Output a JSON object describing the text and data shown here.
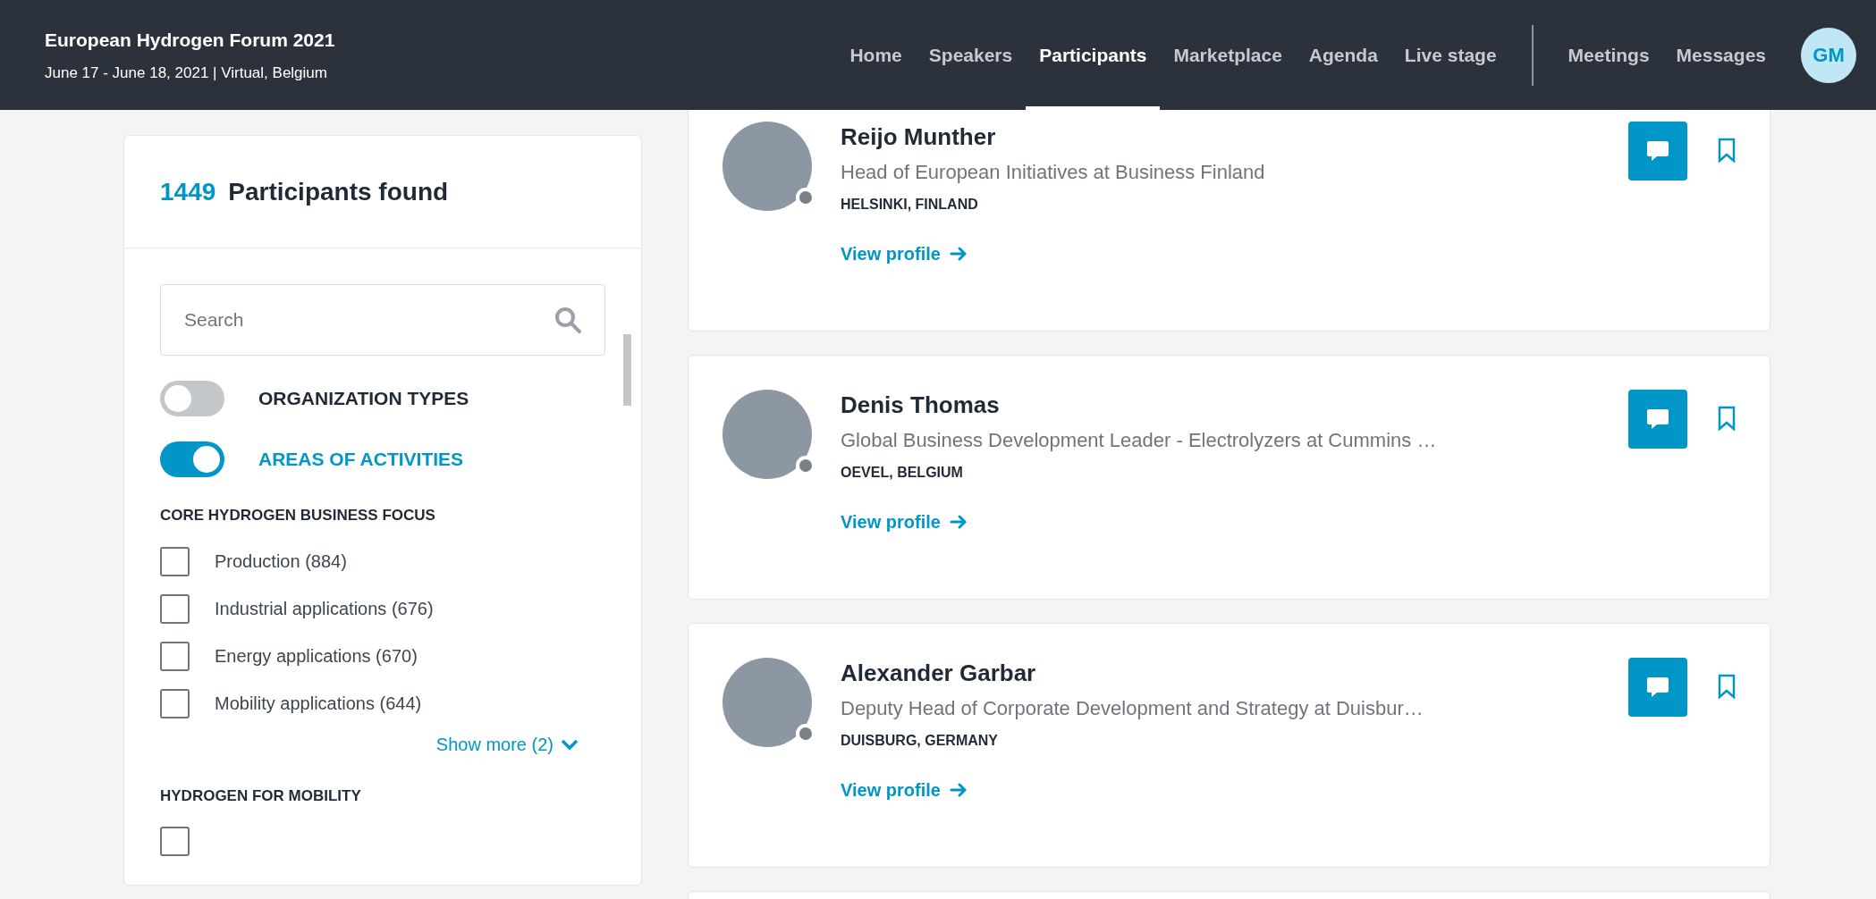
{
  "event": {
    "title": "European Hydrogen Forum 2021",
    "subtitle": "June 17 - June 18, 2021 | Virtual, Belgium"
  },
  "nav": {
    "main": [
      {
        "label": "Home",
        "selected": false
      },
      {
        "label": "Speakers",
        "selected": false
      },
      {
        "label": "Participants",
        "selected": true
      },
      {
        "label": "Marketplace",
        "selected": false
      },
      {
        "label": "Agenda",
        "selected": false
      },
      {
        "label": "Live stage",
        "selected": false
      }
    ],
    "personal": [
      {
        "label": "Meetings",
        "selected": false
      },
      {
        "label": "Messages",
        "selected": false
      }
    ]
  },
  "user": {
    "initials": "GM"
  },
  "filters": {
    "count": "1449",
    "count_label": "Participants found",
    "search": {
      "placeholder": "Search"
    },
    "toggles": [
      {
        "label": "ORGANIZATION TYPES",
        "on": false
      },
      {
        "label": "AREAS OF ACTIVITIES",
        "on": true
      }
    ],
    "sections": [
      {
        "title": "CORE HYDROGEN BUSINESS FOCUS",
        "items": [
          {
            "label": "Production (884)",
            "checked": false
          },
          {
            "label": "Industrial applications (676)",
            "checked": false
          },
          {
            "label": "Energy applications (670)",
            "checked": false
          },
          {
            "label": "Mobility applications (644)",
            "checked": false
          }
        ],
        "show_more": "Show more (2)"
      },
      {
        "title": "HYDROGEN FOR MOBILITY",
        "items": [
          {
            "checked": false
          }
        ]
      }
    ]
  },
  "participants": [
    {
      "name": "Reijo Munther",
      "title": "Head of European Initiatives at Business Finland",
      "location": "HELSINKI, FINLAND",
      "link": "View profile",
      "online": false
    },
    {
      "name": "Denis Thomas",
      "title": "Global Business Development Leader - Electrolyzers at Cummins …",
      "location": "OEVEL, BELGIUM",
      "link": "View profile",
      "online": false
    },
    {
      "name": "Alexander Garbar",
      "title": "Deputy Head of Corporate Development and Strategy at Duisbur…",
      "location": "DUISBURG, GERMANY",
      "link": "View profile",
      "online": false
    }
  ]
}
